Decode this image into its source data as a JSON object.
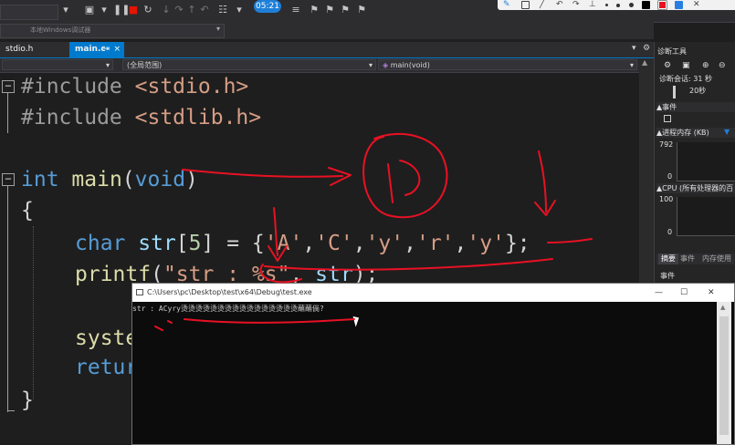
{
  "toolbar": {
    "timer": "05:21"
  },
  "debug_target_label": "本地Windows调试器",
  "tabs": [
    {
      "label": "stdio.h",
      "active": false
    },
    {
      "label": "main.c",
      "active": true,
      "pin": "⇥",
      "close": "×"
    }
  ],
  "navbar": {
    "scope": "(全局范围)",
    "function": "main(void)"
  },
  "code": {
    "line1": {
      "directive": "#include",
      "header": "<stdio.h>"
    },
    "line2": {
      "directive": "#include",
      "header": "<stdlib.h>"
    },
    "line3": {
      "type": "int",
      "name": "main",
      "paren_open": "(",
      "param": "void",
      "paren_close": ")"
    },
    "line4": {
      "brace": "{"
    },
    "line5": {
      "type": "char",
      "var": "str",
      "bracket_open": "[",
      "size": "5",
      "rest": "] = {",
      "elements": [
        "'A'",
        "','",
        "'C'",
        "','",
        "'y'",
        "','",
        "'r'",
        "','",
        "'y'"
      ],
      "end": "};"
    },
    "line6": {
      "fn": "printf",
      "open": "(",
      "fmt": "\"str : %s\"",
      "sep": ", ",
      "arg": "str",
      "close": ");"
    },
    "line7": {
      "fn": "system"
    },
    "line8": {
      "kw": "return"
    },
    "line9": {
      "brace": "}"
    }
  },
  "diagnostics": {
    "title": "诊断工具",
    "session": "诊断会话: 31 秒",
    "time_tick": "20秒",
    "events": "▲事件",
    "memory": "▲进程内存 (KB)",
    "mem_max": "792",
    "mem_min": "0",
    "cpu": "▲CPU (所有处理器的百",
    "cpu_max": "100",
    "cpu_min": "0",
    "tabs": [
      "摘要",
      "事件",
      "内存使用"
    ],
    "events_label": "事件"
  },
  "console": {
    "path": "C:\\Users\\pc\\Desktop\\test\\x64\\Debug\\test.exe",
    "output": "str : ACyry烫烫烫烫烫烫烫烫烫烫烫烫烫烫烫烫蘸蘸倘?",
    "controls": {
      "min": "—",
      "max": "☐",
      "close": "✕"
    }
  },
  "colors": {
    "accent": "#007acc",
    "annotation": "#e81123"
  }
}
